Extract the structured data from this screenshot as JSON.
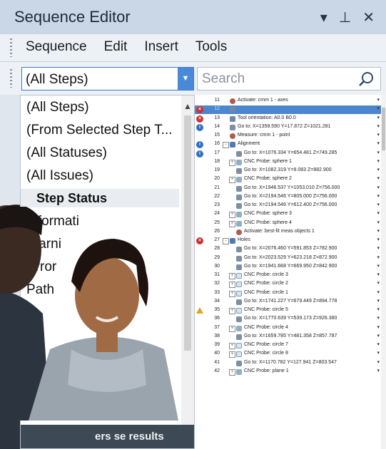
{
  "window": {
    "title": "Sequence Editor"
  },
  "menu": [
    "Sequence",
    "Edit",
    "Insert",
    "Tools"
  ],
  "filter": {
    "value": "(All Steps)"
  },
  "search": {
    "placeholder": "Search"
  },
  "dropdown": {
    "options": [
      "(All Steps)",
      "(From Selected Step T...",
      "(All Statuses)",
      "(All Issues)"
    ],
    "header": "Step Status",
    "status_options": [
      "Informati",
      "Warni",
      "Error",
      "Path"
    ],
    "footer": "ers se  results"
  },
  "steps": [
    {
      "num": "11",
      "label": "Activate: cmm 1 - axes",
      "icon": "measure",
      "indent": 0,
      "status": ""
    },
    {
      "num": "12",
      "label": "",
      "icon": "orient",
      "indent": 0,
      "status": "error",
      "selected": true
    },
    {
      "num": "13",
      "label": "Tool orientation: A0.0 B0.0",
      "icon": "orient",
      "indent": 0,
      "status": "error"
    },
    {
      "num": "14",
      "label": "Go to: X=1358.590 Y=17.872 Z=1021.281",
      "icon": "goto",
      "indent": 0,
      "status": "info"
    },
    {
      "num": "15",
      "label": "Measure: cmm 1 - point",
      "icon": "measure",
      "indent": 0,
      "status": ""
    },
    {
      "num": "16",
      "label": "Alignment",
      "icon": "group",
      "indent": 0,
      "status": "info",
      "expander": "minus"
    },
    {
      "num": "17",
      "label": "Go to: X=1076.334 Y=654.481 Z=749.285",
      "icon": "goto",
      "indent": 1,
      "status": "info"
    },
    {
      "num": "18",
      "label": "CNC Probe: sphere 1",
      "icon": "probe",
      "indent": 1,
      "status": "",
      "expander": "plus"
    },
    {
      "num": "19",
      "label": "Go to: X=1082.319 Y=9.083 Z=882.900",
      "icon": "goto",
      "indent": 1,
      "status": ""
    },
    {
      "num": "20",
      "label": "CNC Probe: sphere 2",
      "icon": "probe",
      "indent": 1,
      "status": "",
      "expander": "plus"
    },
    {
      "num": "21",
      "label": "Go to: X=1946.537 Y=1053.010 Z=756.000",
      "icon": "goto",
      "indent": 1,
      "status": ""
    },
    {
      "num": "22",
      "label": "Go to: X=2194.546 Y=805.000 Z=756.000",
      "icon": "goto",
      "indent": 1,
      "status": ""
    },
    {
      "num": "23",
      "label": "Go to: X=2194.546 Y=612.400 Z=756.000",
      "icon": "goto",
      "indent": 1,
      "status": ""
    },
    {
      "num": "24",
      "label": "CNC Probe: sphere 3",
      "icon": "probe",
      "indent": 1,
      "status": "",
      "expander": "plus"
    },
    {
      "num": "25",
      "label": "CNC Probe: sphere 4",
      "icon": "probe",
      "indent": 1,
      "status": "",
      "expander": "plus"
    },
    {
      "num": "26",
      "label": "Activate: best-fit meas objects 1",
      "icon": "measure",
      "indent": 1,
      "status": ""
    },
    {
      "num": "27",
      "label": "Holes",
      "icon": "group",
      "indent": 0,
      "status": "error",
      "expander": "minus"
    },
    {
      "num": "28",
      "label": "Go to: X=2076.460 Y=591.853 Z=782.900",
      "icon": "goto",
      "indent": 1,
      "status": ""
    },
    {
      "num": "29",
      "label": "Go to: X=2023.529 Y=623.218 Z=872.900",
      "icon": "goto",
      "indent": 1,
      "status": ""
    },
    {
      "num": "30",
      "label": "Go to: X=1941.668 Y=669.950 Z=842.900",
      "icon": "goto",
      "indent": 1,
      "status": ""
    },
    {
      "num": "31",
      "label": "CNC Probe: circle 3",
      "icon": "circle",
      "indent": 1,
      "status": "",
      "expander": "plus"
    },
    {
      "num": "32",
      "label": "CNC Probe: circle 2",
      "icon": "circle",
      "indent": 1,
      "status": "",
      "expander": "plus"
    },
    {
      "num": "33",
      "label": "CNC Probe: circle 1",
      "icon": "circle",
      "indent": 1,
      "status": "",
      "expander": "plus"
    },
    {
      "num": "34",
      "label": "Go to: X=1741.227 Y=679.449 Z=894.778",
      "icon": "goto",
      "indent": 1,
      "status": ""
    },
    {
      "num": "35",
      "label": "CNC Probe: circle 5",
      "icon": "circle",
      "indent": 1,
      "status": "warn",
      "expander": "plus"
    },
    {
      "num": "36",
      "label": "Go to: X=1770.639 Y=539.173 Z=926.380",
      "icon": "goto",
      "indent": 1,
      "status": ""
    },
    {
      "num": "37",
      "label": "CNC Probe: circle 4",
      "icon": "probe",
      "indent": 1,
      "status": "",
      "expander": "plus"
    },
    {
      "num": "38",
      "label": "Go to: X=1659.785 Y=481.358 Z=857.787",
      "icon": "goto",
      "indent": 1,
      "status": ""
    },
    {
      "num": "39",
      "label": "CNC Probe: circle 7",
      "icon": "circle",
      "indent": 1,
      "status": "",
      "expander": "plus"
    },
    {
      "num": "40",
      "label": "CNC Probe: circle 8",
      "icon": "circle",
      "indent": 1,
      "status": "",
      "expander": "plus"
    },
    {
      "num": "41",
      "label": "Go to: X=1170.782 Y=127.941 Z=803.547",
      "icon": "goto",
      "indent": 1,
      "status": ""
    },
    {
      "num": "42",
      "label": "CNC Probe: plane 1",
      "icon": "probe",
      "indent": 1,
      "status": "",
      "expander": "plus"
    }
  ]
}
